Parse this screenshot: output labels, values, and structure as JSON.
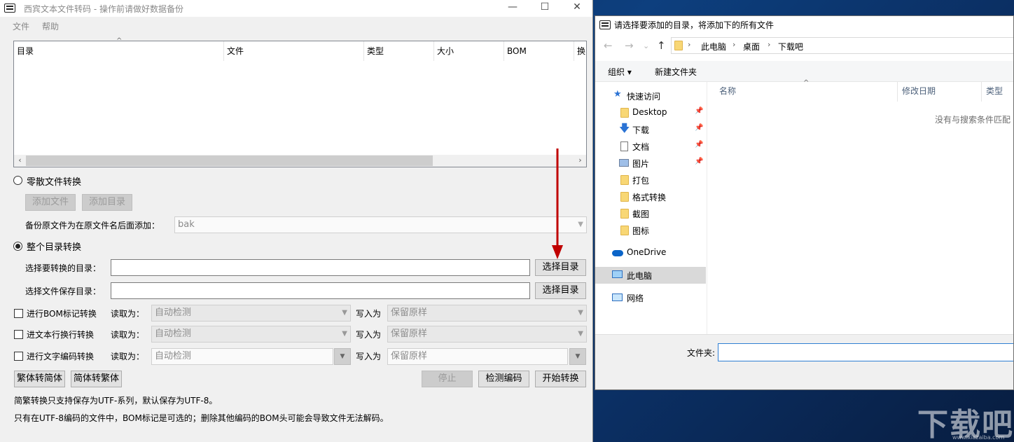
{
  "app": {
    "title": "西宾文本文件转码 - 操作前请做好数据备份",
    "window_controls": {
      "minimize": "—",
      "maximize": "☐",
      "close": "✕"
    },
    "menu": [
      "文件",
      "帮助"
    ],
    "list_columns": [
      "目录",
      "文件",
      "类型",
      "大小",
      "BOM",
      "换"
    ],
    "scroll_left": "‹",
    "scroll_right": "›",
    "scattered": {
      "radio_label": "零散文件转换",
      "add_file": "添加文件",
      "add_dir": "添加目录",
      "backup_label": "备份原文件为在原文件名后面添加：",
      "backup_value": "bak"
    },
    "whole_dir": {
      "radio_label": "整个目录转换",
      "source_label": "选择要转换的目录：",
      "source_value": "",
      "source_button": "选择目录",
      "save_label": "选择文件保存目录：",
      "save_value": "",
      "save_button": "选择目录"
    },
    "options": [
      {
        "label": "进行BOM标记转换",
        "read_label": "读取为：",
        "read_value": "自动检测",
        "write_label": "写入为",
        "write_value": "保留原样"
      },
      {
        "label": "进文本行换行转换",
        "read_label": "读取为：",
        "read_value": "自动检测",
        "write_label": "写入为",
        "write_value": "保留原样"
      },
      {
        "label": "进行文字编码转换",
        "read_label": "读取为：",
        "read_value": "自动检测",
        "write_label": "写入为",
        "write_value": "保留原样"
      }
    ],
    "buttons": {
      "trad_to_simp": "繁体转简体",
      "simp_to_trad": "简体转繁体",
      "stop": "停止",
      "detect": "检测编码",
      "start": "开始转换"
    },
    "notes": [
      "简繁转换只支持保存为UTF-系列，默认保存为UTF-8。",
      "只有在UTF-8编码的文件中，BOM标记是可选的；删除其他编码的BOM头可能会导致文件无法解码。"
    ]
  },
  "dialog": {
    "title": "请选择要添加的目录，将添加下的所有文件",
    "breadcrumb": [
      "此电脑",
      "桌面",
      "下载吧"
    ],
    "toolbar": {
      "organize": "组织 ▾",
      "new_folder": "新建文件夹"
    },
    "nav_items": [
      {
        "label": "快速访问",
        "icon": "star-icon"
      },
      {
        "label": "Desktop",
        "icon": "folder-icon",
        "pinned": true
      },
      {
        "label": "下载",
        "icon": "download-icon",
        "pinned": true
      },
      {
        "label": "文档",
        "icon": "document-icon",
        "pinned": true
      },
      {
        "label": "图片",
        "icon": "picture-icon",
        "pinned": true
      },
      {
        "label": "打包",
        "icon": "folder-icon"
      },
      {
        "label": "格式转换",
        "icon": "folder-icon"
      },
      {
        "label": "截图",
        "icon": "folder-icon"
      },
      {
        "label": "图标",
        "icon": "folder-icon"
      },
      {
        "label": "OneDrive",
        "icon": "cloud-icon"
      },
      {
        "label": "此电脑",
        "icon": "computer-icon",
        "selected": true
      },
      {
        "label": "网络",
        "icon": "network-icon"
      }
    ],
    "columns": [
      "名称",
      "修改日期",
      "类型"
    ],
    "empty_message": "没有与搜索条件匹配",
    "folder_label": "文件夹:",
    "folder_value": ""
  },
  "watermark": {
    "text": "下载吧",
    "sub": "www.xiazaiba.com"
  },
  "colors": {
    "selected_nav": "#d9d9d9",
    "input_focus": "#2f7fd3",
    "arrow": "#c00000"
  }
}
